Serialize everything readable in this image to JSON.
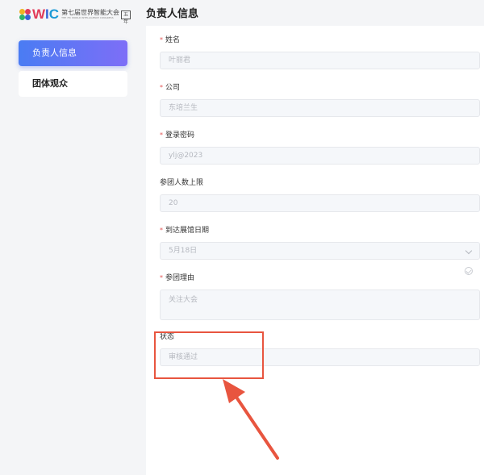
{
  "logo": {
    "wic": [
      "W",
      "I",
      "C"
    ],
    "cn": "第七届世界智能大会",
    "en": "THE 7th WORLD INTELLIGENCE CONGRESS",
    "box": "五年"
  },
  "sidebar": {
    "items": [
      {
        "label": "负责人信息",
        "active": true
      },
      {
        "label": "团体观众",
        "active": false
      }
    ]
  },
  "main": {
    "title": "负责人信息",
    "fields": [
      {
        "label": "姓名",
        "required": true,
        "value": "叶丽君"
      },
      {
        "label": "公司",
        "required": true,
        "value": "东培兰生"
      },
      {
        "label": "登录密码",
        "required": true,
        "value": "ylj@2023"
      },
      {
        "label": "参团人数上限",
        "required": false,
        "value": "20"
      },
      {
        "label": "到达展馆日期",
        "required": true,
        "value": "5月18日"
      },
      {
        "label": "参团理由",
        "required": true,
        "value": "关注大会"
      },
      {
        "label": "状态",
        "required": false,
        "value": "审核通过"
      }
    ]
  },
  "colors": {
    "accent_start": "#4a7cf3",
    "accent_end": "#7d6ef7",
    "required": "#e25555",
    "annotation": "#e8553f"
  }
}
